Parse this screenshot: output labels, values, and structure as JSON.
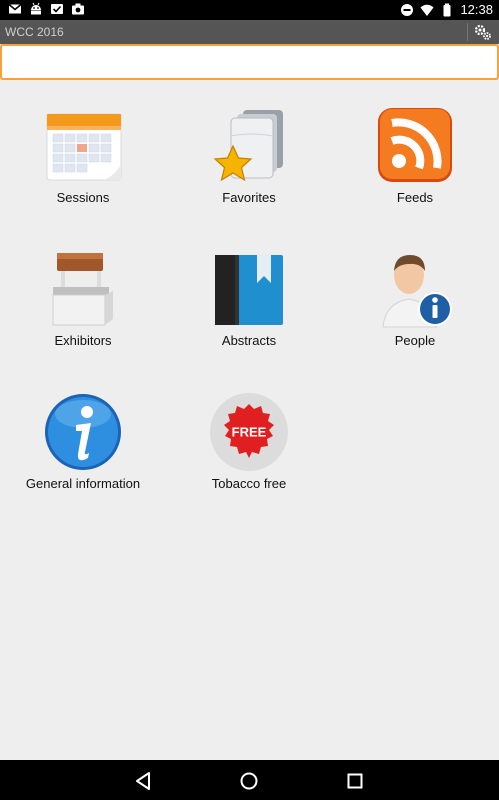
{
  "status_bar": {
    "time": "12:38",
    "left_icons": [
      "gmail-icon",
      "android-icon",
      "image-check-icon",
      "camera-icon"
    ],
    "right_icons": [
      "do-not-disturb-icon",
      "wifi-icon",
      "battery-icon"
    ]
  },
  "app_bar": {
    "title": "WCC 2016",
    "settings_icon": "settings-gears-icon"
  },
  "search": {
    "value": "",
    "placeholder": ""
  },
  "tiles": [
    {
      "label": "Sessions",
      "icon": "calendar-icon"
    },
    {
      "label": "Favorites",
      "icon": "favorites-folder-star-icon"
    },
    {
      "label": "Feeds",
      "icon": "rss-feed-icon"
    },
    {
      "label": "Exhibitors",
      "icon": "exhibitor-booth-icon"
    },
    {
      "label": "Abstracts",
      "icon": "book-bookmark-icon"
    },
    {
      "label": "People",
      "icon": "person-info-icon"
    },
    {
      "label": "General information",
      "icon": "info-icon"
    },
    {
      "label": "Tobacco free",
      "icon": "free-badge-icon",
      "badge_text": "FREE"
    }
  ],
  "nav_bar": {
    "buttons": [
      "back-icon",
      "home-icon",
      "recents-icon"
    ]
  },
  "colors": {
    "accent": "#f7a03c",
    "background": "#eeeeee",
    "title_bar": "#555555"
  }
}
